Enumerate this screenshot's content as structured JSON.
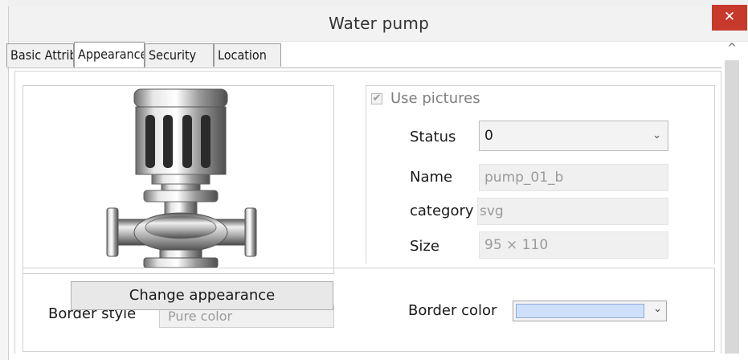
{
  "window": {
    "title": "Water pump",
    "close_glyph": "✕"
  },
  "tabs": [
    {
      "label": "Basic Attributes",
      "active": false
    },
    {
      "label": "Appearance",
      "active": true
    },
    {
      "label": "Security",
      "active": false
    },
    {
      "label": "Location",
      "active": false
    }
  ],
  "scrollbar": {
    "up_glyph": "^"
  },
  "picture": {
    "icon": "water-pump-icon",
    "use_pictures_label": "Use pictures",
    "use_pictures_checked": true,
    "status_label": "Status",
    "status_value": "0",
    "name_label": "Name",
    "name_value": "pump_01_b",
    "category_label": "category",
    "category_value": "svg",
    "size_label": "Size",
    "size_value": "95 × 110"
  },
  "border": {
    "change_button_label": "Change appearance",
    "style_label": "Border style",
    "style_value": "Pure color",
    "color_label": "Border color",
    "color_value": "#cfe0fb"
  },
  "colors": {
    "close_button": "#c7392b",
    "selection": "#cfe0fb"
  }
}
